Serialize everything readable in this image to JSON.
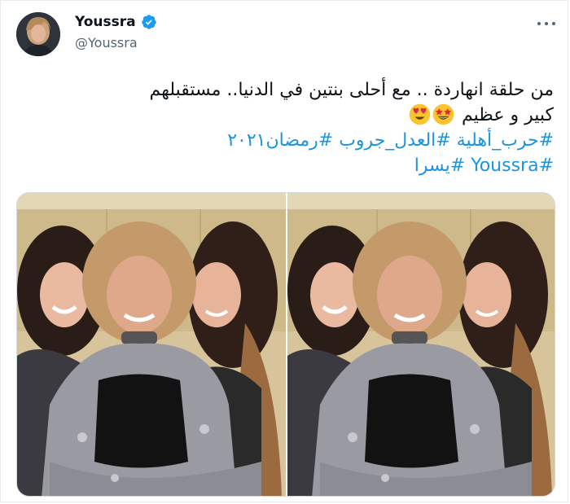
{
  "author": {
    "display_name": "Youssra",
    "handle": "@Youssra",
    "verified": true,
    "avatar_icon": "profile-avatar"
  },
  "tweet": {
    "line1": "من حلقة انهاردة .. مع أحلى بنتين في الدنيا.. مستقبلهم",
    "line2": "كبير و عظيم",
    "line2_emojis": [
      "star-struck-emoji",
      "heart-eyes-emoji"
    ],
    "hashtags_line1": "#حرب_أهلية #العدل_جروب #رمضان٢٠٢١",
    "hashtags_line2": "#Youssra #يسرا"
  },
  "media": {
    "photos": [
      "photo-1",
      "photo-2"
    ]
  },
  "colors": {
    "link": "#1b95e0",
    "verified": "#1d9bf0",
    "text": "#0f1419",
    "secondary": "#536471"
  }
}
